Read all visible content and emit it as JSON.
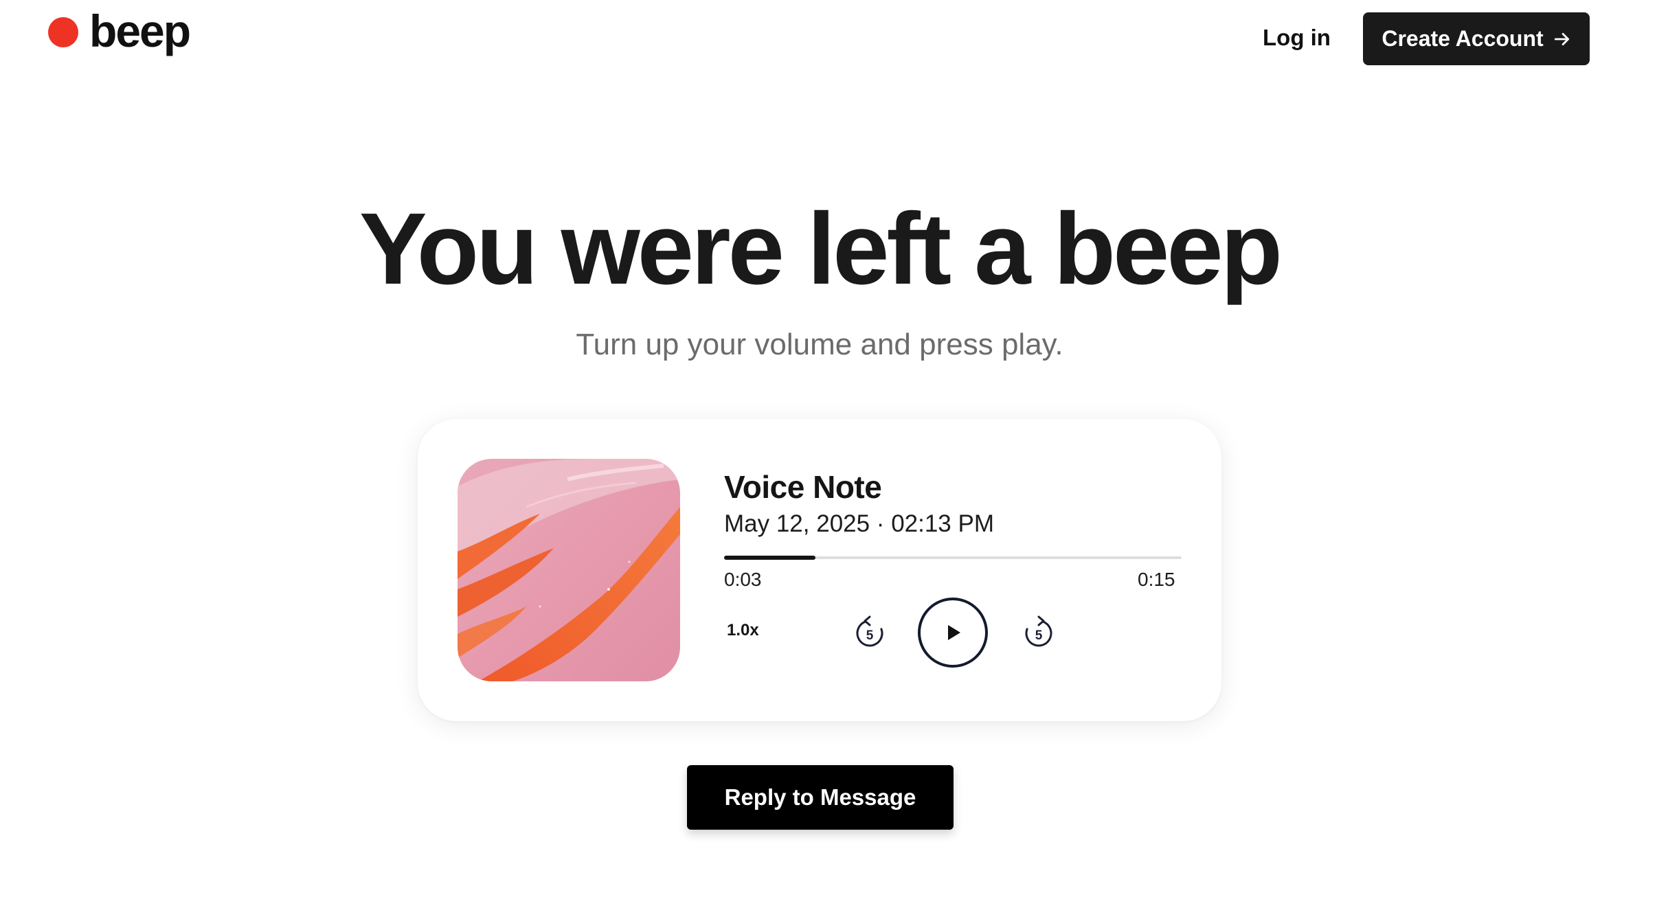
{
  "header": {
    "logo_text": "beep",
    "login_label": "Log in",
    "create_account_label": "Create Account",
    "create_account_icon": "arrow-right-icon"
  },
  "hero": {
    "title": "You were left a beep",
    "subtitle": "Turn up your volume and press play."
  },
  "player": {
    "title": "Voice Note",
    "date": "May 12, 2025 · 02:13 PM",
    "current_time": "0:03",
    "total_time": "0:15",
    "progress": 0.2,
    "speed": "1.0x",
    "skip_back_label": "5",
    "skip_forward_label": "5",
    "icons": {
      "skip_back": "rewind-5-icon",
      "play": "play-icon",
      "skip_forward": "forward-5-icon"
    }
  },
  "reply_label": "Reply to Message",
  "colors": {
    "brand_red": "#ee3325",
    "dark": "#1a1a1a",
    "subtitle_gray": "#6b6b6b",
    "artwork_pink": "#e79aad",
    "artwork_orange": "#f0672f"
  }
}
